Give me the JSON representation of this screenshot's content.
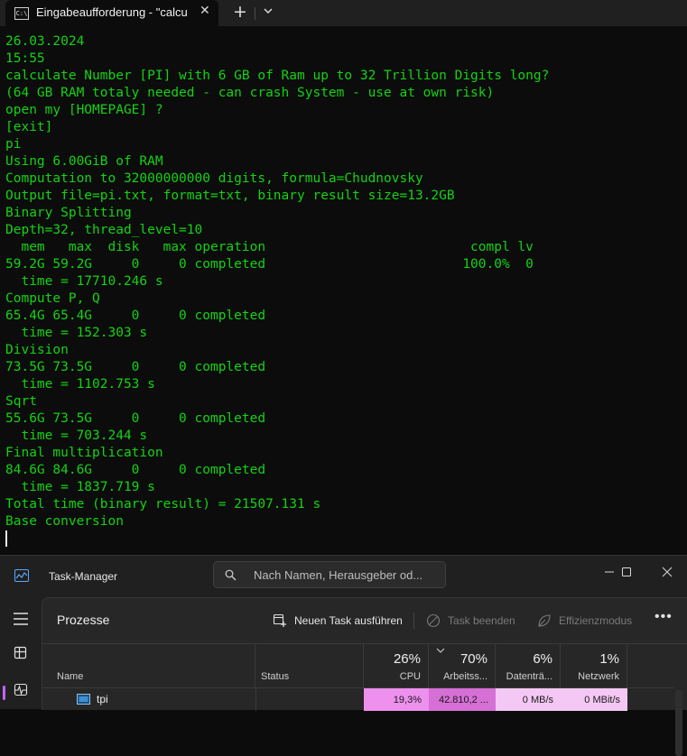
{
  "terminal": {
    "tab_title": "Eingabeaufforderung - \"calcu",
    "new_tab_symbol": "+",
    "close_symbol": "✕",
    "icon_text": "C:\\",
    "lines": [
      "26.03.2024",
      "15:55",
      "calculate Number [PI] with 6 GB of Ram up to 32 Trillion Digits long?",
      "(64 GB RAM totaly needed - can crash System - use at own risk)",
      "open my [HOMEPAGE] ?",
      "[exit]",
      "pi",
      "Using 6.00GiB of RAM",
      "Computation to 32000000000 digits, formula=Chudnovsky",
      "Output file=pi.txt, format=txt, binary result size=13.2GB",
      "Binary Splitting",
      "Depth=32, thread_level=10",
      "  mem   max  disk   max operation                          compl lv",
      "59.2G 59.2G     0     0 completed                         100.0%  0",
      "  time = 17710.246 s",
      "Compute P, Q",
      "65.4G 65.4G     0     0 completed",
      "  time = 152.303 s",
      "Division",
      "73.5G 73.5G     0     0 completed",
      "  time = 1102.753 s",
      "Sqrt",
      "55.6G 73.5G     0     0 completed",
      "  time = 703.244 s",
      "Final multiplication",
      "84.6G 84.6G     0     0 completed",
      "  time = 1837.719 s",
      "Total time (binary result) = 21507.131 s",
      "Base conversion"
    ],
    "text_color": "#13d313",
    "background": "#0c0c0c"
  },
  "taskmanager": {
    "title": "Task-Manager",
    "search_placeholder": "Nach Namen, Herausgeber od...",
    "page_title": "Prozesse",
    "commands": {
      "new_task": "Neuen Task ausführen",
      "end_task": "Task beenden",
      "efficiency": "Effizienzmodus"
    },
    "more_symbol": "•••",
    "columns": {
      "name": "Name",
      "status": "Status",
      "cpu_label": "CPU",
      "cpu_pct": "26%",
      "mem_label": "Arbeitss...",
      "mem_pct": "70%",
      "disk_label": "Datenträ...",
      "disk_pct": "6%",
      "net_label": "Netzwerk",
      "net_pct": "1%"
    },
    "rows": [
      {
        "name": "tpi",
        "status": "",
        "cpu": "19,3%",
        "mem": "42.810,2 ...",
        "disk": "0 MB/s",
        "net": "0 MBit/s"
      }
    ],
    "colors": {
      "cpu_cell": "#ee90ee",
      "mem_cell": "#d66fd6",
      "disk_cell": "#f4c8f4",
      "net_cell": "#f4c8f4",
      "nav_indicator": "#c264ff"
    }
  }
}
